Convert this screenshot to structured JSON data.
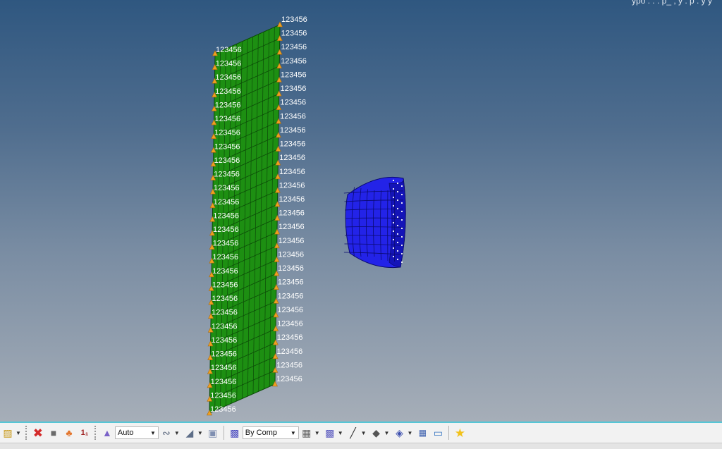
{
  "viewport": {
    "corner_text": "ypo  . . .  p_ ,  y  .  p  .  y  y",
    "node_label": "123456",
    "plate_color": "#1d8f12",
    "ball_color": "#2323e8",
    "constraint_color": "#f0a020"
  },
  "toolbar": {
    "select_auto": "Auto",
    "select_bycomp": "By Comp",
    "icons": [
      "view-icon",
      "delete-icon",
      "mask-icon",
      "organize-icon",
      "numbers-icon",
      "shaded-elements-icon",
      "curves-icon",
      "surfaces-icon",
      "solid-box-icon",
      "color-by-comp-icon",
      "wireframe-icon",
      "shaded-mesh-icon",
      "line-style-icon",
      "plane-icon",
      "layer-icon",
      "windows-icon",
      "monitor-icon",
      "star-icon"
    ]
  }
}
